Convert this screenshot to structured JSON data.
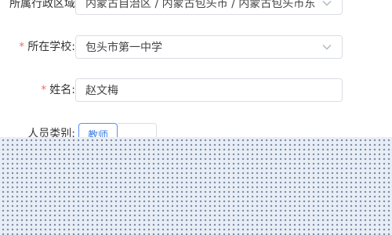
{
  "form": {
    "region": {
      "label": "所属行政区域",
      "value": "内蒙古自治区 / 内蒙古包头市 / 内蒙古包头市东河区"
    },
    "school": {
      "label": "所在学校:",
      "required_mark": "*",
      "value": "包头市第一中学"
    },
    "name": {
      "label": "姓名:",
      "required_mark": "*",
      "value": "赵文梅"
    },
    "category": {
      "label": "人员类别:",
      "selected": "教师"
    }
  }
}
